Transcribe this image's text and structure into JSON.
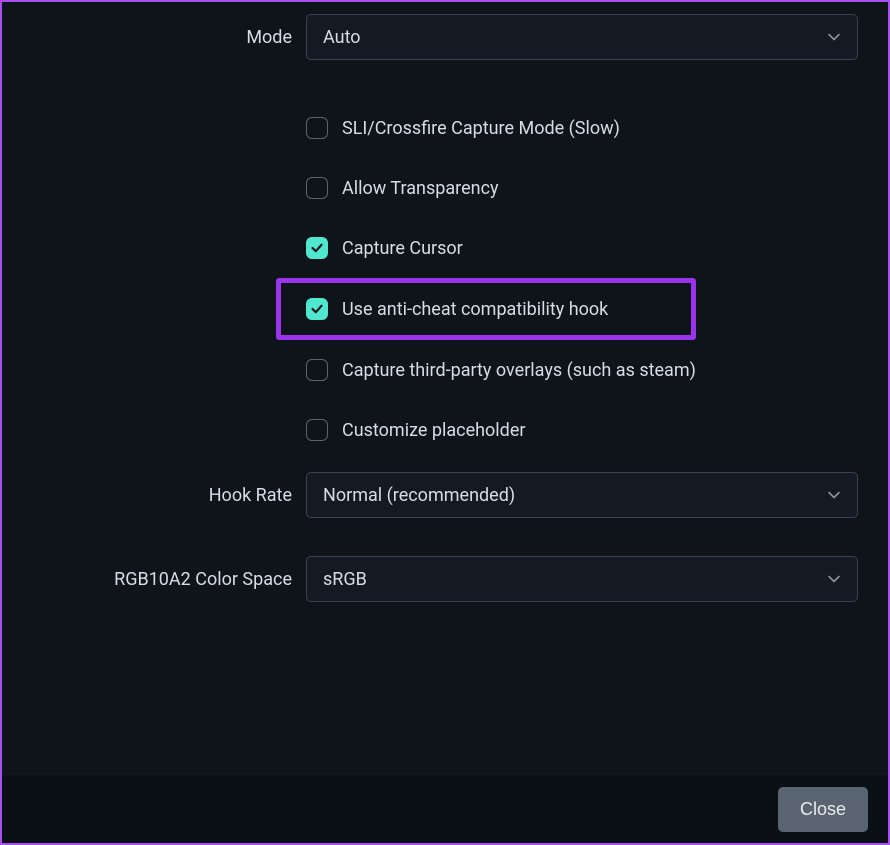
{
  "mode": {
    "label": "Mode",
    "value": "Auto"
  },
  "checkboxes": {
    "sli": {
      "label": "SLI/Crossfire Capture Mode (Slow)",
      "checked": false
    },
    "transparency": {
      "label": "Allow Transparency",
      "checked": false
    },
    "cursor": {
      "label": "Capture Cursor",
      "checked": true
    },
    "anticheat": {
      "label": "Use anti-cheat compatibility hook",
      "checked": true
    },
    "overlays": {
      "label": "Capture third-party overlays (such as steam)",
      "checked": false
    },
    "placeholder": {
      "label": "Customize placeholder",
      "checked": false
    }
  },
  "hookRate": {
    "label": "Hook Rate",
    "value": "Normal (recommended)"
  },
  "colorSpace": {
    "label": "RGB10A2 Color Space",
    "value": "sRGB"
  },
  "footer": {
    "close_label": "Close"
  },
  "colors": {
    "accent": "#4fe8cf",
    "highlight_border": "#9a34eb",
    "window_border": "#a84ff0"
  }
}
